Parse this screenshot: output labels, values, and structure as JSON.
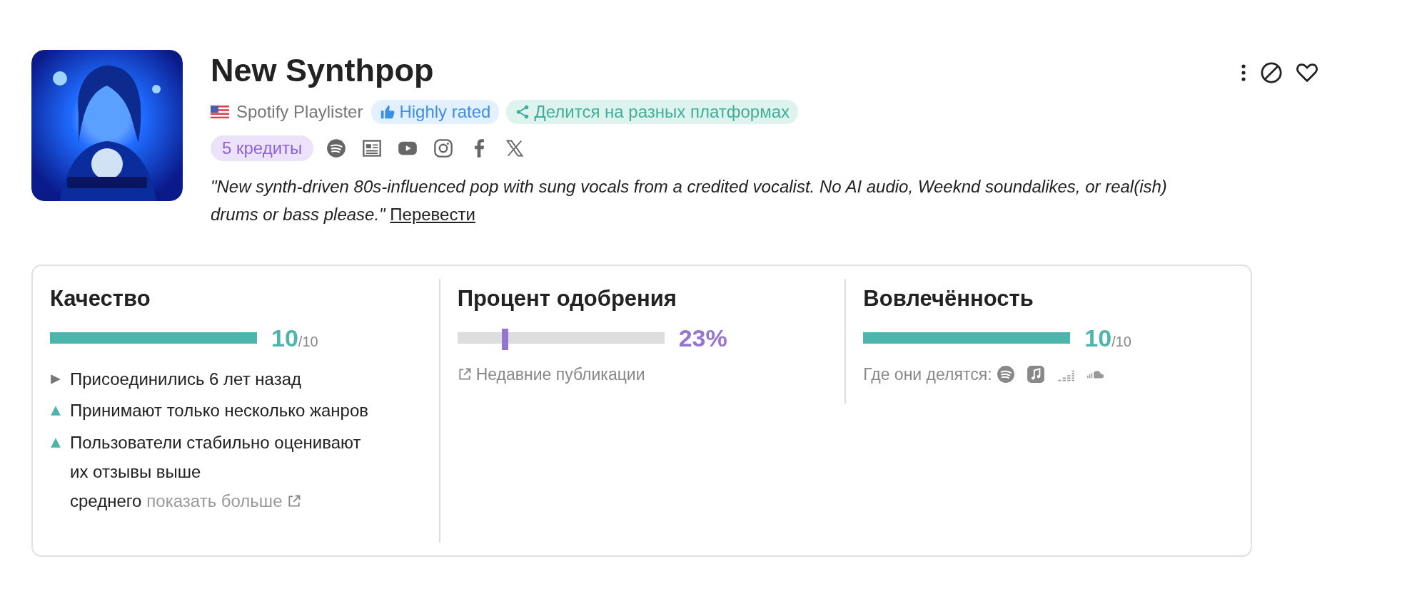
{
  "playlist": {
    "title": "New Synthpop",
    "curator": "Spotify Playlister",
    "badges": [
      {
        "kind": "rated",
        "label": "Highly rated"
      },
      {
        "kind": "share",
        "label": "Делится на разных платформах"
      }
    ],
    "credits": "5 кредиты",
    "links": [
      {
        "kind": "spotify"
      },
      {
        "kind": "news"
      },
      {
        "kind": "youtube"
      },
      {
        "kind": "instagram"
      },
      {
        "kind": "facebook"
      },
      {
        "kind": "x"
      }
    ],
    "description": "\"New synth-driven 80s-influenced pop with sung vocals from a credited vocalist. No AI audio, Weeknd soundalikes, or real(ish) drums or bass please.\"",
    "translate": "Перевести"
  },
  "metrics": [
    {
      "kind": "score",
      "title": "Качество",
      "level": 1,
      "score": "10",
      "max": "/10",
      "notes": [
        {
          "kind": "neutral",
          "text": "Присоединились 6 лет назад"
        },
        {
          "kind": "up",
          "text": "Принимают только несколько жанров"
        },
        {
          "kind": "up",
          "text": "Пользователи стабильно оценивают их отзывы выше среднего",
          "more": "показать больше"
        }
      ]
    },
    {
      "kind": "marker",
      "title": "Процент одобрения",
      "level": 0.23,
      "value": "23%",
      "link": "Недавние публикации"
    },
    {
      "kind": "score",
      "title": "Вовлечённость",
      "level": 1,
      "score": "10",
      "max": "/10",
      "platforms_label": "Где они делятся:",
      "platforms": [
        {
          "kind": "spotify"
        },
        {
          "kind": "music"
        },
        {
          "kind": "bars"
        },
        {
          "kind": "cloud"
        }
      ]
    }
  ]
}
